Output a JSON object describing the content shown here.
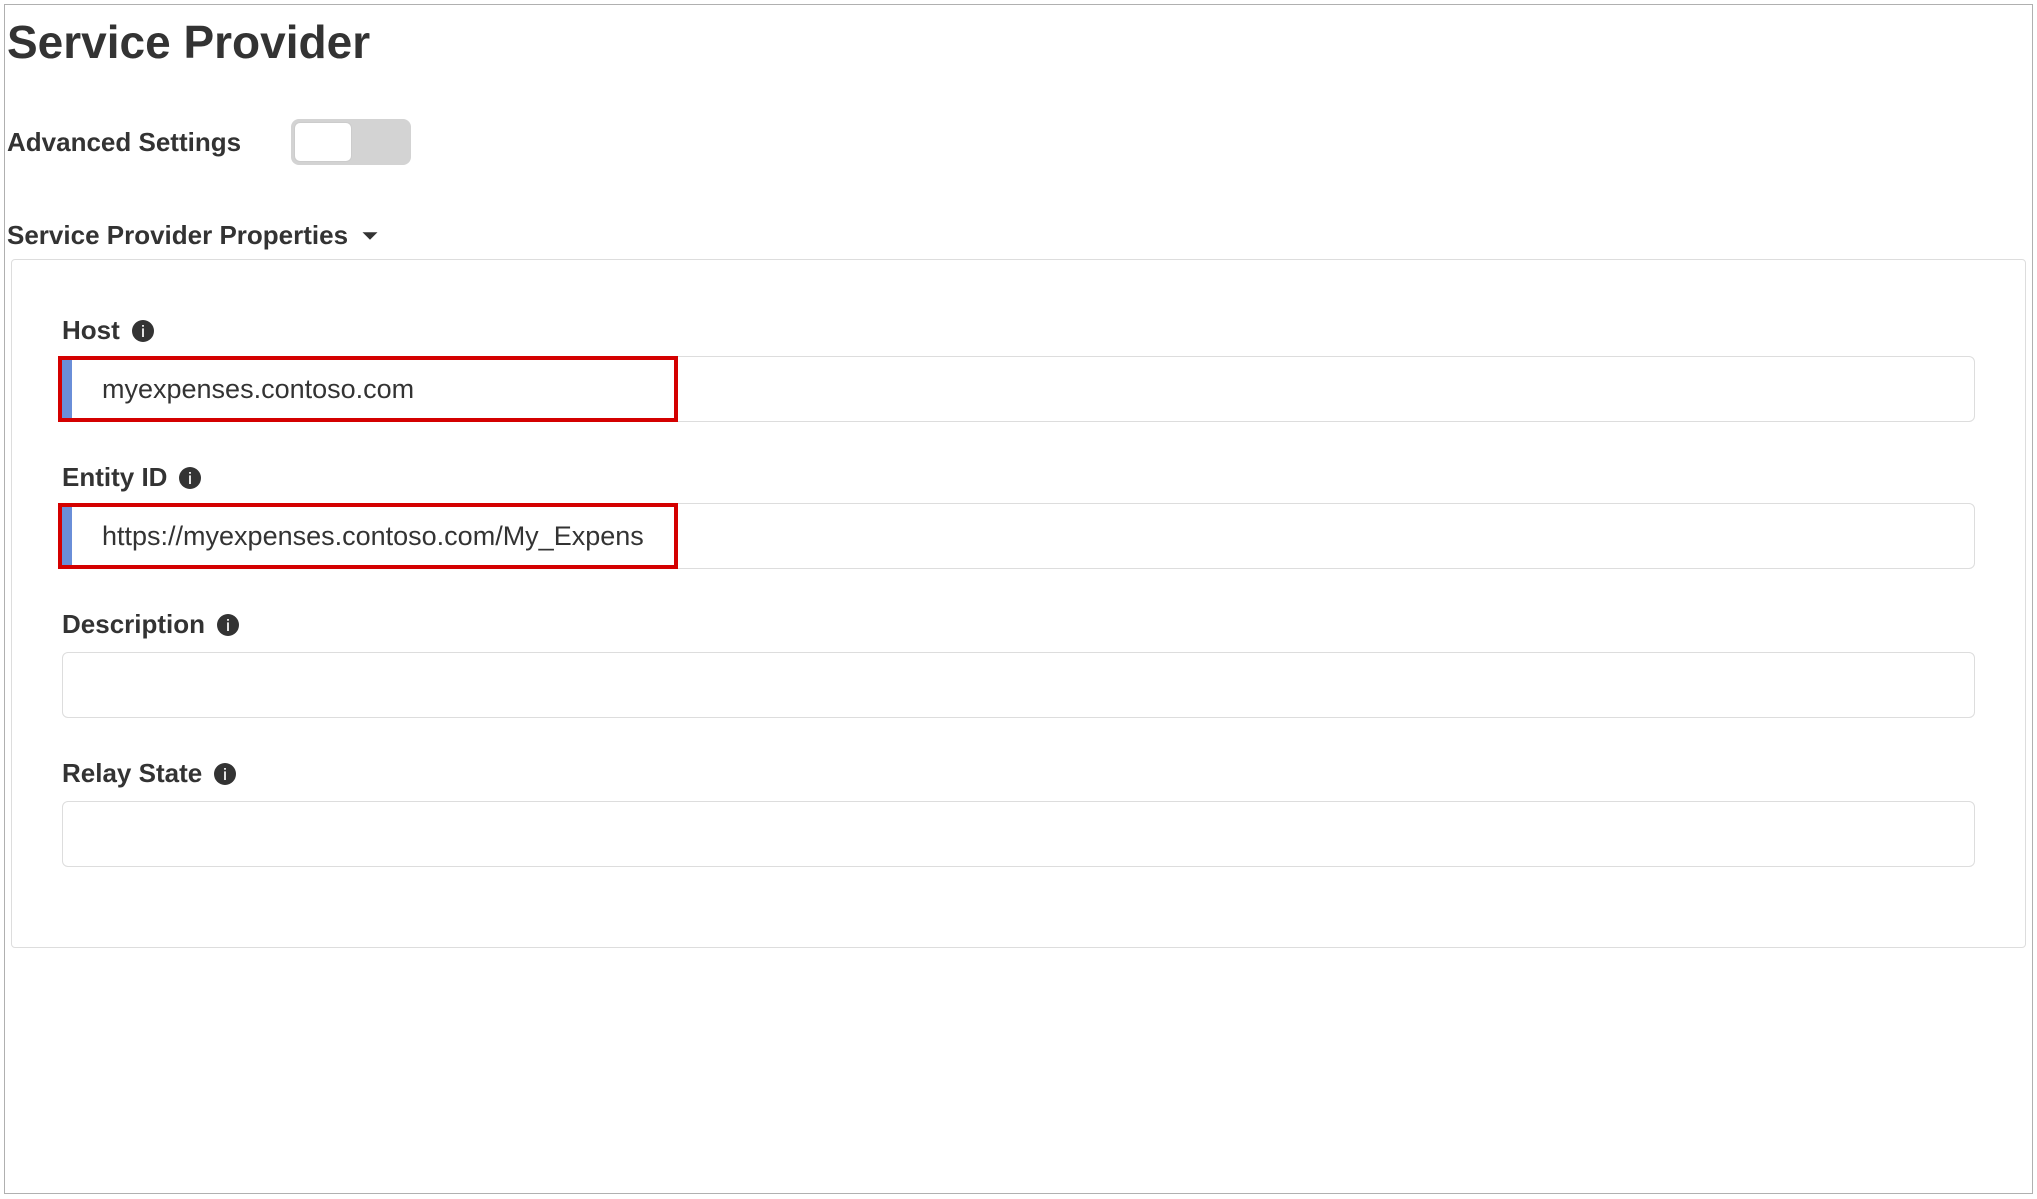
{
  "page": {
    "title": "Service Provider"
  },
  "advanced": {
    "label": "Advanced Settings",
    "toggle_state": "off"
  },
  "section": {
    "title": "Service Provider Properties"
  },
  "fields": {
    "host": {
      "label": "Host",
      "value": "myexpenses.contoso.com"
    },
    "entity_id": {
      "label": "Entity ID",
      "value": "https://myexpenses.contoso.com/My_Expenses"
    },
    "description": {
      "label": "Description",
      "value": ""
    },
    "relay_state": {
      "label": "Relay State",
      "value": ""
    }
  }
}
